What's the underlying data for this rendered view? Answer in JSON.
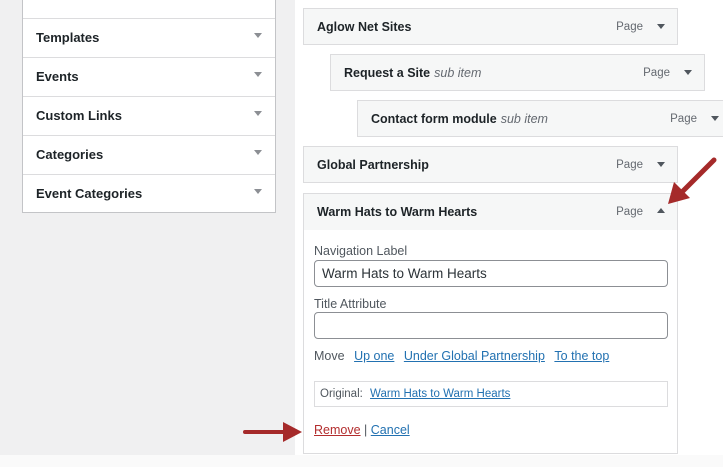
{
  "sidebar": {
    "items": [
      {
        "label": "Templates"
      },
      {
        "label": "Events"
      },
      {
        "label": "Custom Links"
      },
      {
        "label": "Categories"
      },
      {
        "label": "Event Categories"
      }
    ]
  },
  "menu": {
    "items": [
      {
        "title": "Aglow Net Sites",
        "sub": "",
        "type": "Page"
      },
      {
        "title": "Request a Site",
        "sub": "sub item",
        "type": "Page"
      },
      {
        "title": "Contact form module",
        "sub": "sub item",
        "type": "Page"
      },
      {
        "title": "Global Partnership",
        "sub": "",
        "type": "Page"
      },
      {
        "title": "Warm Hats to Warm Hearts",
        "sub": "",
        "type": "Page"
      }
    ]
  },
  "settings": {
    "nav_label_label": "Navigation Label",
    "nav_label_value": "Warm Hats to Warm Hearts",
    "title_attr_label": "Title Attribute",
    "title_attr_value": "",
    "move_label": "Move",
    "move_up": "Up one",
    "move_under": "Under Global Partnership",
    "move_top": "To the top",
    "original_label": "Original:",
    "original_link": "Warm Hats to Warm Hearts",
    "remove": "Remove",
    "separator": "|",
    "cancel": "Cancel"
  },
  "colors": {
    "annotation_arrow": "#a52a2a",
    "link": "#2271b1",
    "remove_link": "#b32d2e"
  },
  "icons": [
    "chevron-down-icon",
    "chevron-up-icon",
    "annotation-arrow-icon"
  ]
}
